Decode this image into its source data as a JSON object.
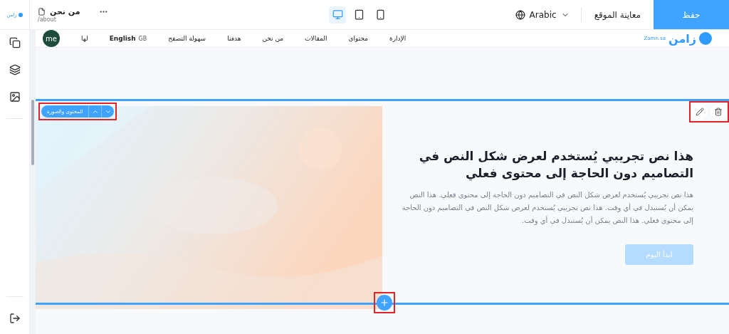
{
  "sidebar_logo": {
    "text": "زامن"
  },
  "page": {
    "title": "من نحن",
    "path": "/about"
  },
  "devices": [
    {
      "kind": "desktop",
      "selected": true
    },
    {
      "kind": "tablet",
      "selected": false
    },
    {
      "kind": "mobile",
      "selected": false
    }
  ],
  "language": {
    "label": "Arabic"
  },
  "preview_label": "معاينة الموقع",
  "save_label": "حفظ",
  "sidebar_tools": [
    {
      "kind": "pages"
    },
    {
      "kind": "layers"
    },
    {
      "kind": "media"
    }
  ],
  "site_header": {
    "logo": "زامن",
    "logo_sub": "Zamn.sa",
    "nav": [
      "الإدارة",
      "محتواي",
      "المقالات",
      "من نحن",
      "هدفنا",
      "سهولة التصفح"
    ],
    "language_flag": "GB",
    "language": "English",
    "extra": "لها",
    "avatar": "me"
  },
  "section": {
    "label": "المحتوى والصورة",
    "heading": "هذا نص تجريبي يُستخدم لعرض شكل النص في التصاميم دون الحاجة إلى محتوى فعلي",
    "body": "هذا نص تجريبي يُستخدم لعرض شكل النص في التصاميم دون الحاجة إلى محتوى فعلي. هذا النص يمكن أن يُستبدل في أي وقت. هذا نص تجريبي يُستخدم لعرض شكل النص في التصاميم دون الحاجة إلى محتوى فعلي. هذا النص يمكن أن يُستبدل في أي وقت.",
    "button": "ابدأ اليوم"
  }
}
